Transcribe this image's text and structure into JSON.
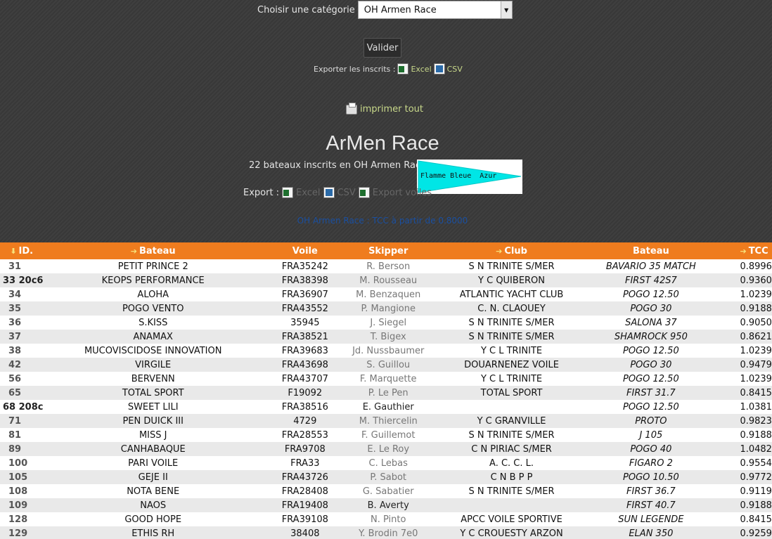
{
  "filter": {
    "label": "Choisir une catégorie",
    "selected": "OH Armen Race",
    "submit": "Valider"
  },
  "export_top": {
    "label": "Exporter les inscrits :",
    "excel": "Excel",
    "csv": "CSV"
  },
  "print_label": "imprimer tout",
  "race": {
    "title": "ArMen Race",
    "subtitle": "22 bateaux inscrits en OH Armen Race",
    "flag_text": "Flamme Bleue  Azur",
    "export_label": "Export :",
    "export_excel": "Excel",
    "export_csv": "CSV",
    "export_voiles": "Export voiles",
    "tcc_note": "OH Armen Race : TCC à partir de 0.8000"
  },
  "colors": {
    "header_bg": "#ef7c1e",
    "flag_color": "#00e6e6"
  },
  "table": {
    "headers": [
      "ID.",
      "Bateau",
      "Voile",
      "Skipper",
      "Club",
      "Bateau",
      "TCC"
    ],
    "rows": [
      {
        "id": "31",
        "bateau": "PETIT PRINCE 2",
        "voile": "FRA35242",
        "skipper": "R. Berson",
        "club": "S N TRINITE S/MER",
        "type": "BAVARIO 35 MATCH",
        "tcc": "0.8996"
      },
      {
        "id": "33 20c6",
        "bateau": "KEOPS PERFORMANCE",
        "voile": "FRA38398",
        "skipper": "M. Rousseau",
        "club": "Y C QUIBERON",
        "type": "FIRST 42S7",
        "tcc": "0.9360"
      },
      {
        "id": "34",
        "bateau": "ALOHA",
        "voile": "FRA36907",
        "skipper": "M. Benzaquen",
        "club": "ATLANTIC YACHT CLUB",
        "type": "POGO 12.50",
        "tcc": "1.0239"
      },
      {
        "id": "35",
        "bateau": "POGO VENTO",
        "voile": "FRA43552",
        "skipper": "P. Mangione",
        "club": "C. N. CLAOUEY",
        "type": "POGO 30",
        "tcc": "0.9188"
      },
      {
        "id": "36",
        "bateau": "S.KISS",
        "voile": "35945",
        "skipper": "J. Siegel",
        "club": "S N TRINITE S/MER",
        "type": "SALONA 37",
        "tcc": "0.9050"
      },
      {
        "id": "37",
        "bateau": "ANAMAX",
        "voile": "FRA38521",
        "skipper": "T. Bigex",
        "club": "S N TRINITE S/MER",
        "type": "SHAMROCK 950",
        "tcc": "0.8621"
      },
      {
        "id": "38",
        "bateau": "MUCOVISCIDOSE INNOVATION",
        "voile": "FRA39683",
        "skipper": "Jd. Nussbaumer",
        "club": "Y C L TRINITE",
        "type": "POGO 12.50",
        "tcc": "1.0239"
      },
      {
        "id": "42",
        "bateau": "VIRGILE",
        "voile": "FRA43698",
        "skipper": "S. Guillou",
        "club": "DOUARNENEZ VOILE",
        "type": "POGO 30",
        "tcc": "0.9479"
      },
      {
        "id": "56",
        "bateau": "BERVENN",
        "voile": "FRA43707",
        "skipper": "F. Marquette",
        "club": "Y C L TRINITE",
        "type": "POGO 12.50",
        "tcc": "1.0239"
      },
      {
        "id": "65",
        "bateau": "TOTAL SPORT",
        "voile": "F19092",
        "skipper": "P. Le Pen",
        "club": "TOTAL SPORT",
        "type": "FIRST 31.7",
        "tcc": "0.8415"
      },
      {
        "id": "68 208c",
        "bateau": "SWEET LILI",
        "voile": "FRA38516",
        "skipper": "E. Gauthier",
        "club": "",
        "type": "POGO 12.50",
        "tcc": "1.0381"
      },
      {
        "id": "71",
        "bateau": "PEN DUICK III",
        "voile": "4729",
        "skipper": "M. Thiercelin",
        "club": "Y C GRANVILLE",
        "type": "PROTO",
        "tcc": "0.9823"
      },
      {
        "id": "81",
        "bateau": "MISS J",
        "voile": "FRA28553",
        "skipper": "F. Guillemot",
        "club": "S N TRINITE S/MER",
        "type": "J 105",
        "tcc": "0.9188"
      },
      {
        "id": "89",
        "bateau": "CANHABAQUE",
        "voile": "FRA9708",
        "skipper": "E. Le Roy",
        "club": "C N PIRIAC S/MER",
        "type": "POGO 40",
        "tcc": "1.0482"
      },
      {
        "id": "100",
        "bateau": "PARI VOILE",
        "voile": "FRA33",
        "skipper": "C. Lebas",
        "club": "A. C. C. L.",
        "type": "FIGARO 2",
        "tcc": "0.9554"
      },
      {
        "id": "105",
        "bateau": "GEJE II",
        "voile": "FRA43726",
        "skipper": "P. Sabot",
        "club": "C N B P P",
        "type": "POGO 10.50",
        "tcc": "0.9772"
      },
      {
        "id": "108",
        "bateau": "NOTA BENE",
        "voile": "FRA28408",
        "skipper": "G. Sabatier",
        "club": "S N TRINITE S/MER",
        "type": "FIRST 36.7",
        "tcc": "0.9119"
      },
      {
        "id": "109",
        "bateau": "NAOS",
        "voile": "FRA19408",
        "skipper": "B. Averty",
        "club": "",
        "type": "FIRST 40.7",
        "tcc": "0.9188"
      },
      {
        "id": "128",
        "bateau": "GOOD HOPE",
        "voile": "FRA39108",
        "skipper": "N. Pinto",
        "club": "APCC VOILE SPORTIVE",
        "type": "SUN LEGENDE",
        "tcc": "0.8415"
      },
      {
        "id": "129",
        "bateau": "ETHIS RH",
        "voile": "38408",
        "skipper": "Y. Brodin 7e0",
        "club": "Y C CROUESTY ARZON",
        "type": "ELAN 350",
        "tcc": "0.9259"
      }
    ]
  }
}
